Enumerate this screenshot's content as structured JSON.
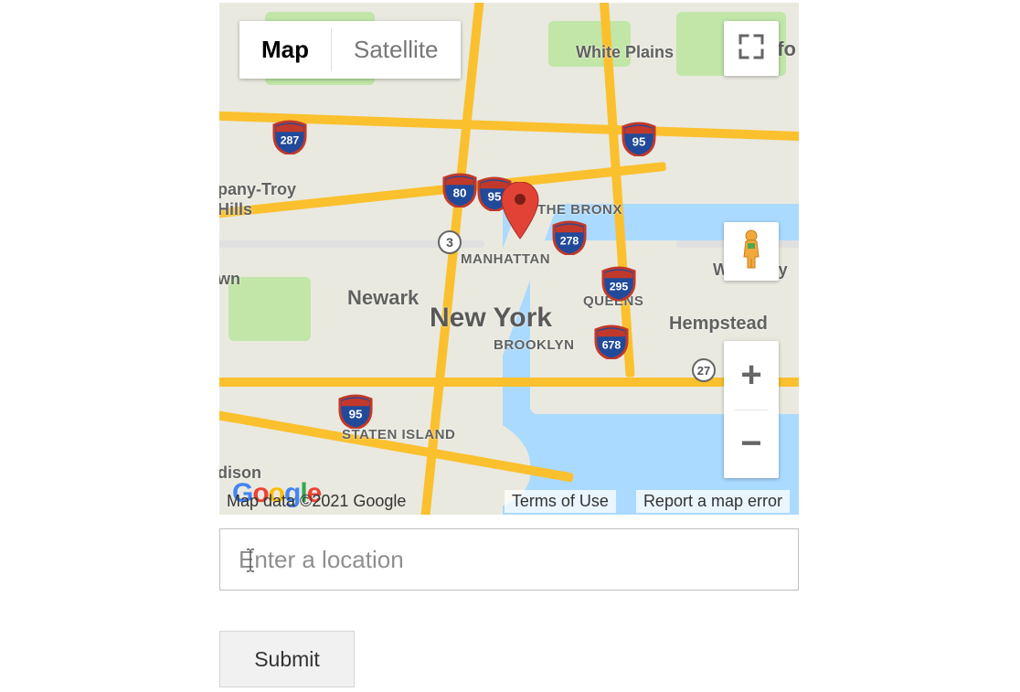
{
  "map": {
    "type_tabs": {
      "map": "Map",
      "satellite": "Satellite",
      "active": "map"
    },
    "center_city": "New York",
    "labels": {
      "white_plains": "White Plains",
      "pany_troy": "pany-Troy",
      "hills": "Hills",
      "wn": "wn",
      "dison": "dison",
      "the_bronx": "THE BRONX",
      "manhattan": "MANHATTAN",
      "newark": "Newark",
      "new_york": "New York",
      "queens": "QUEENS",
      "brooklyn": "BROOKLYN",
      "hempstead": "Hempstead",
      "westbury": "Westbury",
      "staten_island": "STATEN ISLAND",
      "fo": "fo"
    },
    "shields": {
      "i287": "287",
      "i95a": "95",
      "i80": "80",
      "i95b": "95",
      "i278": "278",
      "us3": "3",
      "i295": "295",
      "i678": "678",
      "ny27": "27",
      "i95c": "95"
    },
    "attribution": {
      "data": "Map data ©2021 Google",
      "terms": "Terms of Use",
      "report": "Report a map error"
    },
    "logo": "Google"
  },
  "form": {
    "location_placeholder": "Enter a location",
    "location_value": "",
    "submit_label": "Submit"
  }
}
